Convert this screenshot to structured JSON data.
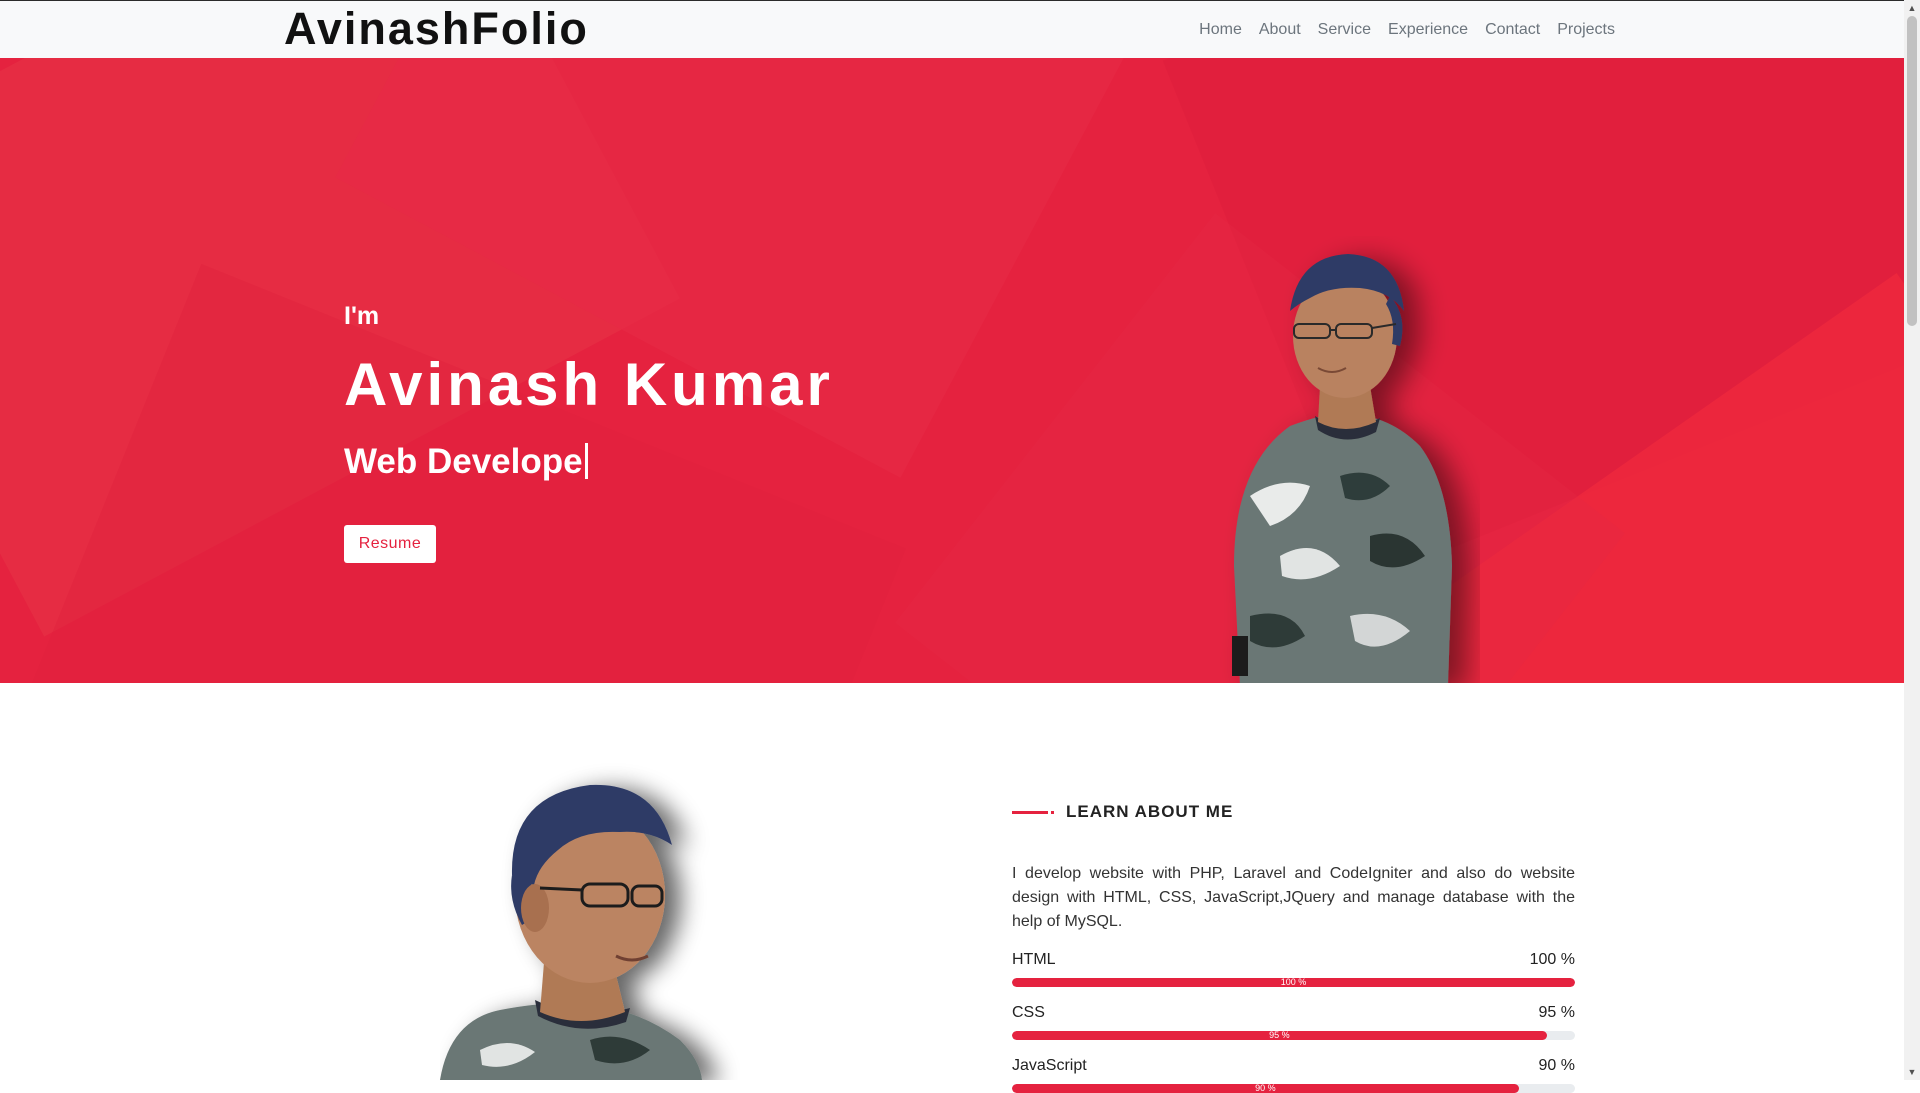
{
  "navbar": {
    "brand": "AvinashFolio",
    "links": [
      "Home",
      "About",
      "Service",
      "Experience",
      "Contact",
      "Projects"
    ]
  },
  "hero": {
    "intro": "I'm",
    "name": "Avinash Kumar",
    "role": "Web Develope",
    "resume_label": "Resume"
  },
  "about": {
    "heading": "LEARN ABOUT ME",
    "description": "I develop website with PHP, Laravel and CodeIgniter and also do website design with HTML, CSS, JavaScript,JQuery and manage database with the help of MySQL.",
    "skills": [
      {
        "name": "HTML",
        "percent_label": "100 %",
        "bar_label": "100 %",
        "level": 100
      },
      {
        "name": "CSS",
        "percent_label": "95 %",
        "bar_label": "95 %",
        "level": 95
      },
      {
        "name": "JavaScript",
        "percent_label": "90 %",
        "bar_label": "90 %",
        "level": 90
      }
    ]
  },
  "colors": {
    "accent": "#e5223f",
    "navbar_bg": "#f8f9fa",
    "nav_link": "#6c757d"
  },
  "icons": {
    "scroll_up": "triangle-up-icon",
    "scroll_down": "triangle-down-icon"
  }
}
